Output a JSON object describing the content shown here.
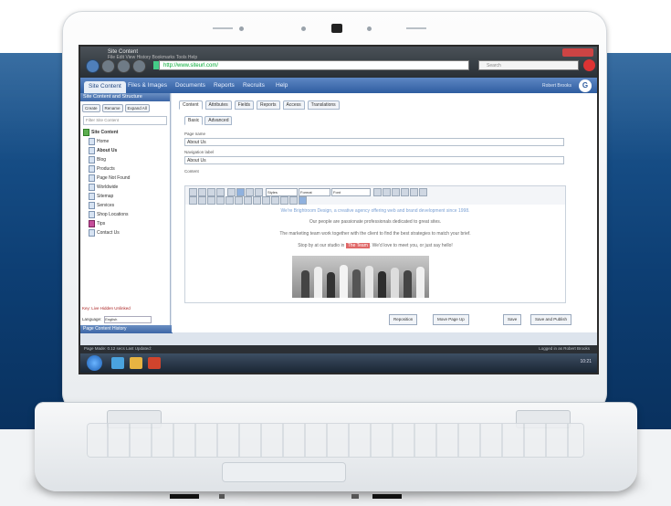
{
  "browser": {
    "title": "Site Content",
    "menu": "File  Edit  View  History  Bookmarks  Tools  Help",
    "address": "http://www.siteurl.com/",
    "search_placeholder": "Search"
  },
  "app": {
    "tabs": [
      "Site Content",
      "Files & Images",
      "Documents",
      "Reports",
      "Recruits",
      "Help"
    ],
    "username": "Robert Brooks"
  },
  "sidebar": {
    "header": "Site Content and Structure",
    "buttons": [
      "Create",
      "Rename",
      "Expand All",
      "Collapse All"
    ],
    "search": "Filter Site Content",
    "tree": [
      {
        "label": "Site Content",
        "style": "bold green"
      },
      {
        "label": "Home",
        "style": ""
      },
      {
        "label": "About Us",
        "style": "bold"
      },
      {
        "label": "Blog",
        "style": ""
      },
      {
        "label": "Products",
        "style": ""
      },
      {
        "label": "Page Not Found",
        "style": ""
      },
      {
        "label": "Worldwide",
        "style": ""
      },
      {
        "label": "Sitemap",
        "style": ""
      },
      {
        "label": "Services",
        "style": ""
      },
      {
        "label": "Shop Locations",
        "style": ""
      },
      {
        "label": "Tips",
        "style": "pink"
      },
      {
        "label": "Contact Us",
        "style": ""
      }
    ],
    "legend": "Key:  Live  Hidden  Unlinked",
    "language_label": "Language:",
    "language_value": "English",
    "section": "Page Content History"
  },
  "main": {
    "tabs": [
      "Content",
      "Attributes",
      "Fields",
      "Reports",
      "Access",
      "Translations"
    ],
    "subtabs": [
      "Basic",
      "Advanced"
    ],
    "page_name_label": "Page name",
    "page_name": "About Us",
    "nav_label": "Navigation label",
    "nav_value": "About Us",
    "content_label": "Content",
    "style_select": "Styles",
    "format_select": "Format",
    "font_select": "Font",
    "editor_lines": [
      "We're Brightroom Design, a creative agency offering web and brand development since 1998.",
      "Our people are passionate professionals dedicated to great sites.",
      "The marketing team work together with the client to find the best strategies to match your brief.",
      "Stop by at our studio in ",
      "The Team",
      ". We'd love to meet you, or just say hello!"
    ],
    "actions": [
      "Reposition",
      "Move Page Up",
      "Save",
      "Save and Publish"
    ]
  },
  "statusbar": {
    "left": "Page Made: 0.12 secs  Last Updated:",
    "right": "Logged in as Robert Brooks"
  },
  "taskbar": {
    "clock": "10:21"
  }
}
